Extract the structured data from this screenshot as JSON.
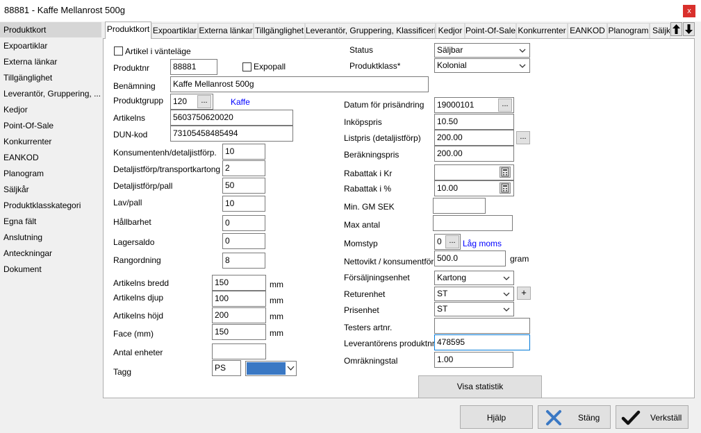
{
  "window": {
    "title": "88881 - Kaffe Mellanrost 500g",
    "close_label": "x"
  },
  "sidebar": {
    "items": [
      {
        "label": "Produktkort"
      },
      {
        "label": "Expoartiklar"
      },
      {
        "label": "Externa länkar"
      },
      {
        "label": "Tillgänglighet"
      },
      {
        "label": "Leverantör, Gruppering, ..."
      },
      {
        "label": "Kedjor"
      },
      {
        "label": "Point-Of-Sale"
      },
      {
        "label": "Konkurrenter"
      },
      {
        "label": "EANKOD"
      },
      {
        "label": "Planogram"
      },
      {
        "label": "Säljkår"
      },
      {
        "label": "Produktklasskategori"
      },
      {
        "label": "Egna fält"
      },
      {
        "label": "Anslutning"
      },
      {
        "label": "Anteckningar"
      },
      {
        "label": "Dokument"
      }
    ]
  },
  "tabs": [
    {
      "label": "Produktkort"
    },
    {
      "label": "Expoartiklar"
    },
    {
      "label": "Externa länkar"
    },
    {
      "label": "Tillgänglighet"
    },
    {
      "label": "Leverantör, Gruppering, Klassificering"
    },
    {
      "label": "Kedjor"
    },
    {
      "label": "Point-Of-Sale"
    },
    {
      "label": "Konkurrenter"
    },
    {
      "label": "EANKOD"
    },
    {
      "label": "Planogram"
    },
    {
      "label": "Säljk"
    }
  ],
  "left": {
    "waiting_label": "Artikel i vänteläge",
    "produktnr": {
      "label": "Produktnr",
      "value": "88881"
    },
    "expopall_label": "Expopall",
    "benamning": {
      "label": "Benämning",
      "value": "Kaffe Mellanrost 500g"
    },
    "produktgrupp": {
      "label": "Produktgrupp",
      "value": "120",
      "link": "Kaffe"
    },
    "artikelns": {
      "label": "Artikelns",
      "value": "5603750620020"
    },
    "dunkod": {
      "label": "DUN-kod",
      "value": "73105458485494"
    },
    "konsumentenh": {
      "label": "Konsumentenh/detaljistförp.",
      "value": "10"
    },
    "detaljist_transport": {
      "label": "Detaljistförp/transportkartong",
      "value": "2"
    },
    "detaljist_pall": {
      "label": "Detaljistförp/pall",
      "value": "50"
    },
    "lav_pall": {
      "label": "Lav/pall",
      "value": "10"
    },
    "hallbarhet": {
      "label": "Hållbarhet",
      "value": "0"
    },
    "lagersaldo": {
      "label": "Lagersaldo",
      "value": "0"
    },
    "rangordning": {
      "label": "Rangordning",
      "value": "8"
    },
    "bredd": {
      "label": "Artikelns bredd",
      "value": "150",
      "unit": "mm"
    },
    "djup": {
      "label": "Artikelns djup",
      "value": "100",
      "unit": "mm"
    },
    "hojd": {
      "label": "Artikelns höjd",
      "value": "200",
      "unit": "mm"
    },
    "face": {
      "label": "Face (mm)",
      "value": "150",
      "unit": "mm"
    },
    "antal_enheter": {
      "label": "Antal enheter",
      "value": ""
    },
    "tagg": {
      "label": "Tagg",
      "value": "PS",
      "color": "#3a78c4"
    }
  },
  "right": {
    "status": {
      "label": "Status",
      "value": "Säljbar"
    },
    "produktklass": {
      "label": "Produktklass*",
      "value": "Kolonial"
    },
    "datum": {
      "label": "Datum för prisändring",
      "value": "19000101"
    },
    "inkopspris": {
      "label": "Inköpspris",
      "value": "10.50"
    },
    "listpris": {
      "label": "Listpris (detaljistförp)",
      "value": "200.00"
    },
    "berakningspris": {
      "label": "Beräkningspris",
      "value": "200.00"
    },
    "rabatt_kr": {
      "label": "Rabattak i Kr",
      "value": ""
    },
    "rabatt_pct": {
      "label": "Rabattak i %",
      "value": "10.00"
    },
    "min_gm": {
      "label": "Min. GM SEK",
      "value": ""
    },
    "max_antal": {
      "label": "Max antal",
      "value": ""
    },
    "momstyp": {
      "label": "Momstyp",
      "value": "0",
      "link": "Låg moms"
    },
    "nettovikt": {
      "label": "Nettovikt / konsumentförp",
      "value": "500.0",
      "unit": "gram"
    },
    "forsaljningsenhet": {
      "label": "Försäljningsenhet",
      "value": "Kartong"
    },
    "returenhet": {
      "label": "Returenhet",
      "value": "ST"
    },
    "prisenhet": {
      "label": "Prisenhet",
      "value": "ST"
    },
    "testers": {
      "label": "Testers artnr.",
      "value": ""
    },
    "lev_produktnr": {
      "label": "Leverantörens produktnr",
      "value": "478595"
    },
    "omrakningstal": {
      "label": "Omräkningstal",
      "value": "1.00"
    },
    "visa_statistik": "Visa statistik",
    "plus_label": "+",
    "dots_label": "..."
  },
  "footer": {
    "help": "Hjälp",
    "close": "Stäng",
    "apply": "Verkställ"
  }
}
